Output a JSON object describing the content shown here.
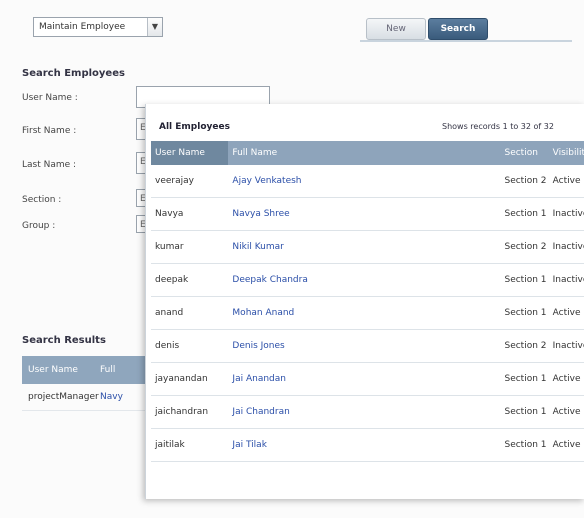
{
  "top": {
    "select_value": "Maintain Employee",
    "tab_new": "New",
    "tab_search": "Search"
  },
  "search_form": {
    "heading": "Search Employees",
    "labels": [
      "User Name :",
      "First Name :",
      "Last Name :",
      "Section :",
      "Group :"
    ]
  },
  "search_results": {
    "heading": "Search Results",
    "columns": [
      "User Name",
      "Full"
    ],
    "row": {
      "user": "projectManager",
      "full": "Navy"
    }
  },
  "panel": {
    "title": "All Employees",
    "count": "Shows records 1 to 32 of 32",
    "columns": [
      "User Name",
      "Full Name",
      "Section",
      "Visibility"
    ],
    "rows": [
      {
        "user": "veerajay",
        "full": "Ajay Venkatesh",
        "section": "Section 2",
        "vis": "Active"
      },
      {
        "user": "Navya",
        "full": "Navya Shree",
        "section": "Section 1",
        "vis": "Inactive"
      },
      {
        "user": "kumar",
        "full": "Nikil Kumar",
        "section": "Section 2",
        "vis": "Inactive"
      },
      {
        "user": "deepak",
        "full": "Deepak Chandra",
        "section": "Section 1",
        "vis": "Inactive"
      },
      {
        "user": "anand",
        "full": "Mohan Anand",
        "section": "Section 1",
        "vis": "Active"
      },
      {
        "user": "denis",
        "full": "Denis Jones",
        "section": "Section 2",
        "vis": "Inactive"
      },
      {
        "user": "jayanandan",
        "full": "Jai Anandan",
        "section": "Section 1",
        "vis": "Active"
      },
      {
        "user": "jaichandran",
        "full": "Jai Chandran",
        "section": "Section 1",
        "vis": "Active"
      },
      {
        "user": "jaitilak",
        "full": "Jai Tilak",
        "section": "Section 1",
        "vis": "Active"
      }
    ]
  }
}
